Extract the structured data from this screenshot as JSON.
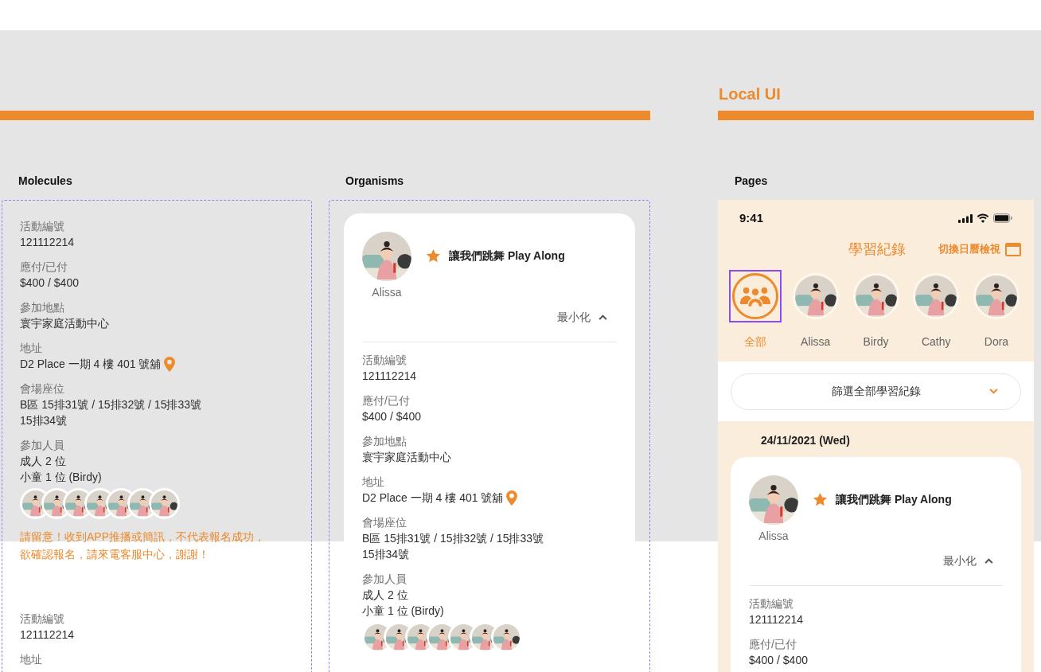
{
  "canvas_heading": "Local UI",
  "molecules": {
    "label": "Molecules",
    "fields": [
      {
        "kind": "text",
        "label": "活動編號",
        "lines": [
          "121112214"
        ]
      },
      {
        "kind": "text",
        "label": "應付/已付",
        "lines": [
          "$400 / $400"
        ]
      },
      {
        "kind": "text",
        "label": "參加地點",
        "lines": [
          "寰宇家庭活動中心"
        ]
      },
      {
        "kind": "address",
        "label": "地址",
        "lines": [
          "D2 Place 一期 4 樓 401 號舖"
        ]
      },
      {
        "kind": "text",
        "label": "會場座位",
        "lines": [
          "B區 15排31號 / 15排32號 / 15排33號",
          "15排34號"
        ]
      },
      {
        "kind": "people",
        "label": "參加人員",
        "lines": [
          "成人 2 位",
          "小童 1 位 (Birdy)"
        ]
      }
    ],
    "notice": "請留意！收到APP推播或簡訊，不代表報名成功，欲確認報名，請來電客服中心，謝謝！",
    "fields_2": [
      {
        "kind": "text",
        "label": "活動編號",
        "lines": [
          "121112214"
        ]
      },
      {
        "kind": "text",
        "label": "地址"
      }
    ]
  },
  "organisms": {
    "label": "Organisms",
    "card": {
      "name": "Alissa",
      "starred": true,
      "title": "讓我們跳舞 Play Along",
      "collapse": "最小化",
      "fields": [
        {
          "kind": "text",
          "label": "活動編號",
          "lines": [
            "121112214"
          ]
        },
        {
          "kind": "text",
          "label": "應付/已付",
          "lines": [
            "$400 / $400"
          ]
        },
        {
          "kind": "text",
          "label": "參加地點",
          "lines": [
            "寰宇家庭活動中心"
          ]
        },
        {
          "kind": "address",
          "label": "地址",
          "lines": [
            "D2 Place 一期 4 樓 401 號舖"
          ]
        },
        {
          "kind": "text",
          "label": "會場座位",
          "lines": [
            "B區 15排31號 / 15排32號 / 15排33號",
            "15排34號"
          ]
        },
        {
          "kind": "people",
          "label": "參加人員",
          "lines": [
            "成人 2 位",
            "小童 1 位 (Birdy)"
          ]
        }
      ]
    }
  },
  "pages": {
    "label": "Pages",
    "status_time": "9:41",
    "title": "學習紀錄",
    "calendar_link": "切換日曆檢視",
    "children": [
      {
        "kind": "all",
        "label": "全部",
        "selected": true
      },
      {
        "kind": "person",
        "label": "Alissa",
        "selected": false
      },
      {
        "kind": "person",
        "label": "Birdy",
        "selected": false
      },
      {
        "kind": "person",
        "label": "Cathy",
        "selected": false
      },
      {
        "kind": "person",
        "label": "Dora",
        "selected": false
      }
    ],
    "filter": "篩選全部學習紀錄",
    "date": "24/11/2021 (Wed)",
    "card": {
      "name": "Alissa",
      "starred": true,
      "title": "讓我們跳舞 Play Along",
      "collapse": "最小化",
      "fields": [
        {
          "kind": "text",
          "label": "活動編號",
          "lines": [
            "121112214"
          ]
        },
        {
          "kind": "text",
          "label": "應付/已付",
          "lines": [
            "$400 / $400"
          ]
        }
      ]
    }
  }
}
